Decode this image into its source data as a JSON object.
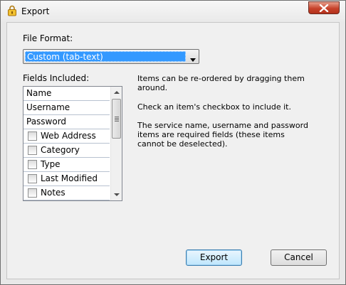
{
  "window": {
    "title": "Export",
    "icon": "lock-icon"
  },
  "format": {
    "label": "File Format:",
    "selected": "Custom (tab-text)"
  },
  "fields": {
    "label": "Fields Included:",
    "items": [
      {
        "label": "Name",
        "checkbox": false
      },
      {
        "label": "Username",
        "checkbox": false
      },
      {
        "label": "Password",
        "checkbox": false
      },
      {
        "label": "Web Address",
        "checkbox": true,
        "checked": false
      },
      {
        "label": "Category",
        "checkbox": true,
        "checked": false
      },
      {
        "label": "Type",
        "checkbox": true,
        "checked": false
      },
      {
        "label": "Last Modified",
        "checkbox": true,
        "checked": false
      },
      {
        "label": "Notes",
        "checkbox": true,
        "checked": false
      }
    ]
  },
  "instructions": {
    "p1": "Items can be re-ordered by dragging them around.",
    "p2": "Check an item's checkbox to include it.",
    "p3": "The service name, username and password items are required fields (these items cannot be deselected)."
  },
  "buttons": {
    "export": "Export",
    "cancel": "Cancel"
  },
  "colors": {
    "selection": "#3399ff",
    "close": "#c7432b"
  }
}
